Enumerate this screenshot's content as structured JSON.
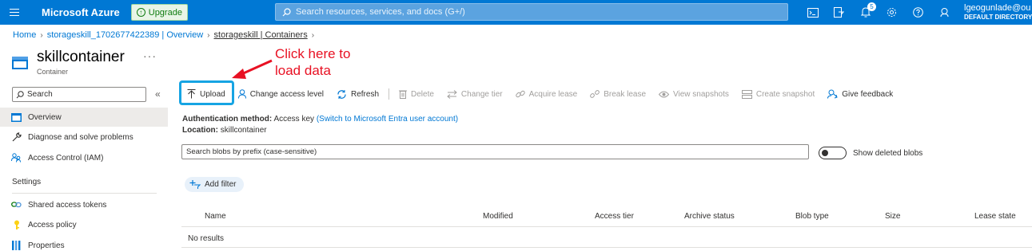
{
  "topbar": {
    "brand": "Microsoft Azure",
    "upgrade_label": "Upgrade",
    "search_placeholder": "Search resources, services, and docs (G+/)",
    "notification_count": "5",
    "account_name": "lgeogunlade@ou",
    "account_directory": "DEFAULT DIRECTORY (IC",
    "icons": [
      "cloud-shell-icon",
      "directory-filter-icon",
      "notifications-icon",
      "settings-icon",
      "help-icon",
      "feedback-icon"
    ]
  },
  "breadcrumb": {
    "items": [
      "Home",
      "storageskill_1702677422389 | Overview",
      "storageskill | Containers"
    ]
  },
  "page": {
    "title": "skillcontainer",
    "subtitle": "Container",
    "more": "···"
  },
  "annotation": {
    "text_line1": "Click here to",
    "text_line2": "load data",
    "color": "#e81123"
  },
  "nav": {
    "search_placeholder": "Search",
    "collapse": "«",
    "items": [
      {
        "label": "Overview",
        "icon": "overview-icon",
        "active": true
      },
      {
        "label": "Diagnose and solve problems",
        "icon": "wrench-icon"
      },
      {
        "label": "Access Control (IAM)",
        "icon": "people-icon"
      }
    ],
    "section_settings": "Settings",
    "settings_items": [
      {
        "label": "Shared access tokens",
        "icon": "link-icon"
      },
      {
        "label": "Access policy",
        "icon": "key-icon"
      },
      {
        "label": "Properties",
        "icon": "properties-icon"
      }
    ]
  },
  "toolbar": {
    "upload": "Upload",
    "change_access_level": "Change access level",
    "refresh": "Refresh",
    "delete": "Delete",
    "change_tier": "Change tier",
    "acquire_lease": "Acquire lease",
    "break_lease": "Break lease",
    "view_snapshots": "View snapshots",
    "create_snapshot": "Create snapshot",
    "give_feedback": "Give feedback"
  },
  "info": {
    "auth_label": "Authentication method:",
    "auth_value": "Access key",
    "auth_link": "(Switch to Microsoft Entra user account)",
    "location_label": "Location:",
    "location_value": "skillcontainer"
  },
  "blobs": {
    "search_placeholder": "Search blobs by prefix (case-sensitive)",
    "show_deleted_label": "Show deleted blobs",
    "show_deleted": false,
    "add_filter": "Add filter",
    "columns": [
      "Name",
      "Modified",
      "Access tier",
      "Archive status",
      "Blob type",
      "Size",
      "Lease state"
    ],
    "empty_text": "No results"
  },
  "colors": {
    "accent": "#0078d4",
    "highlight": "#16a4e3",
    "annotation": "#e81123"
  }
}
